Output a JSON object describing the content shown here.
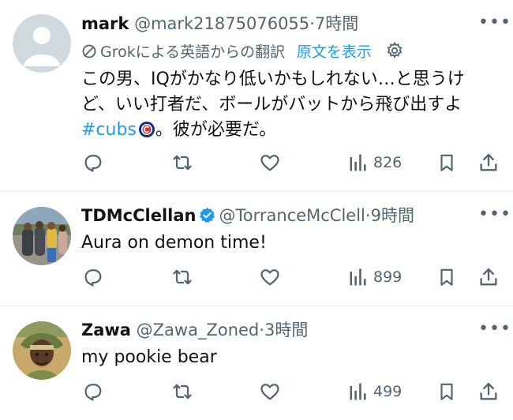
{
  "tweets": [
    {
      "name": "mark",
      "handle": "@mark21875076055",
      "time": "7時間",
      "translation_note": "Grokによる英語からの翻訳",
      "show_original": "原文を表示",
      "text_line1": "この男、IQがかなり低いかもしれない…と思うけ",
      "text_line2": "ど、いい打者だ、ボールがバットから飛び出すよ",
      "hashtag": "#cubs",
      "text_after_hashtag": "。彼が必要だ。",
      "views": "826"
    },
    {
      "name": "TDMcClellan",
      "handle": "@TorranceMcClell",
      "time": "9時間",
      "text": "Aura on demon time!",
      "views": "899"
    },
    {
      "name": "Zawa",
      "handle": "@Zawa_Zoned",
      "time": "3時間",
      "text": "my pookie bear",
      "views": "499"
    }
  ],
  "separator": "·",
  "more_icon_glyph": "•••",
  "icons": [
    "reply-icon",
    "retweet-icon",
    "like-icon",
    "views-icon",
    "bookmark-icon",
    "share-icon",
    "gear-icon",
    "verified-badge-icon",
    "translate-icon"
  ],
  "colors": {
    "accent": "#1d9bf0",
    "muted": "#536471",
    "text": "#0f1419",
    "divider": "#eff3f4"
  }
}
